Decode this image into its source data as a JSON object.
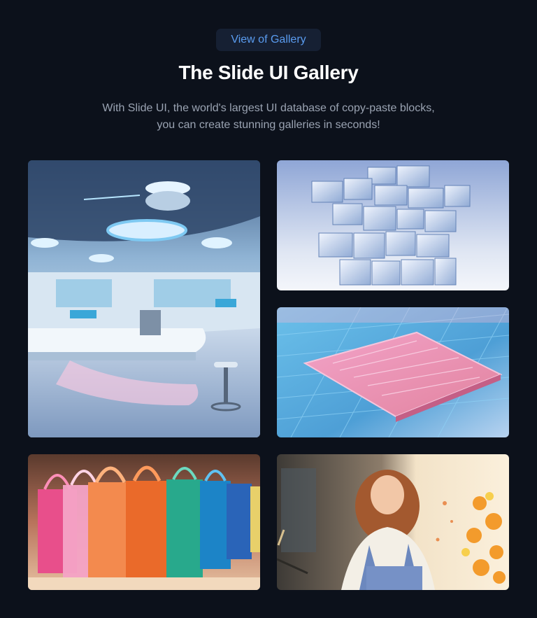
{
  "header": {
    "badge_label": "View of Gallery",
    "title": "The Slide UI Gallery",
    "subtitle_line1": "With Slide UI, the world's largest UI database of copy-paste blocks,",
    "subtitle_line2": "you can create stunning galleries in seconds!"
  },
  "gallery": {
    "images": [
      {
        "icon": "laboratory-photo",
        "colors": {
          "primary": "#7fa6cc",
          "accent": "#e9f3fb"
        }
      },
      {
        "icon": "glass-cubes-photo",
        "colors": {
          "primary": "#c9d7ee",
          "accent": "#7f9fcf"
        }
      },
      {
        "icon": "microchip-photo",
        "colors": {
          "primary": "#5fb2e6",
          "accent": "#f3a1c7"
        }
      },
      {
        "icon": "shopping-bags-photo",
        "colors": {
          "primary": "#f27a3e",
          "accent": "#1fa3c9"
        }
      },
      {
        "icon": "woman-painting-photo",
        "colors": {
          "primary": "#f1d7b2",
          "accent": "#6f86b7"
        }
      }
    ]
  },
  "theme": {
    "background": "#0c111b",
    "badge_background": "#162033",
    "badge_text": "#5a9cf0",
    "title_color": "#ffffff",
    "subtitle_color": "#9aa3b2"
  }
}
